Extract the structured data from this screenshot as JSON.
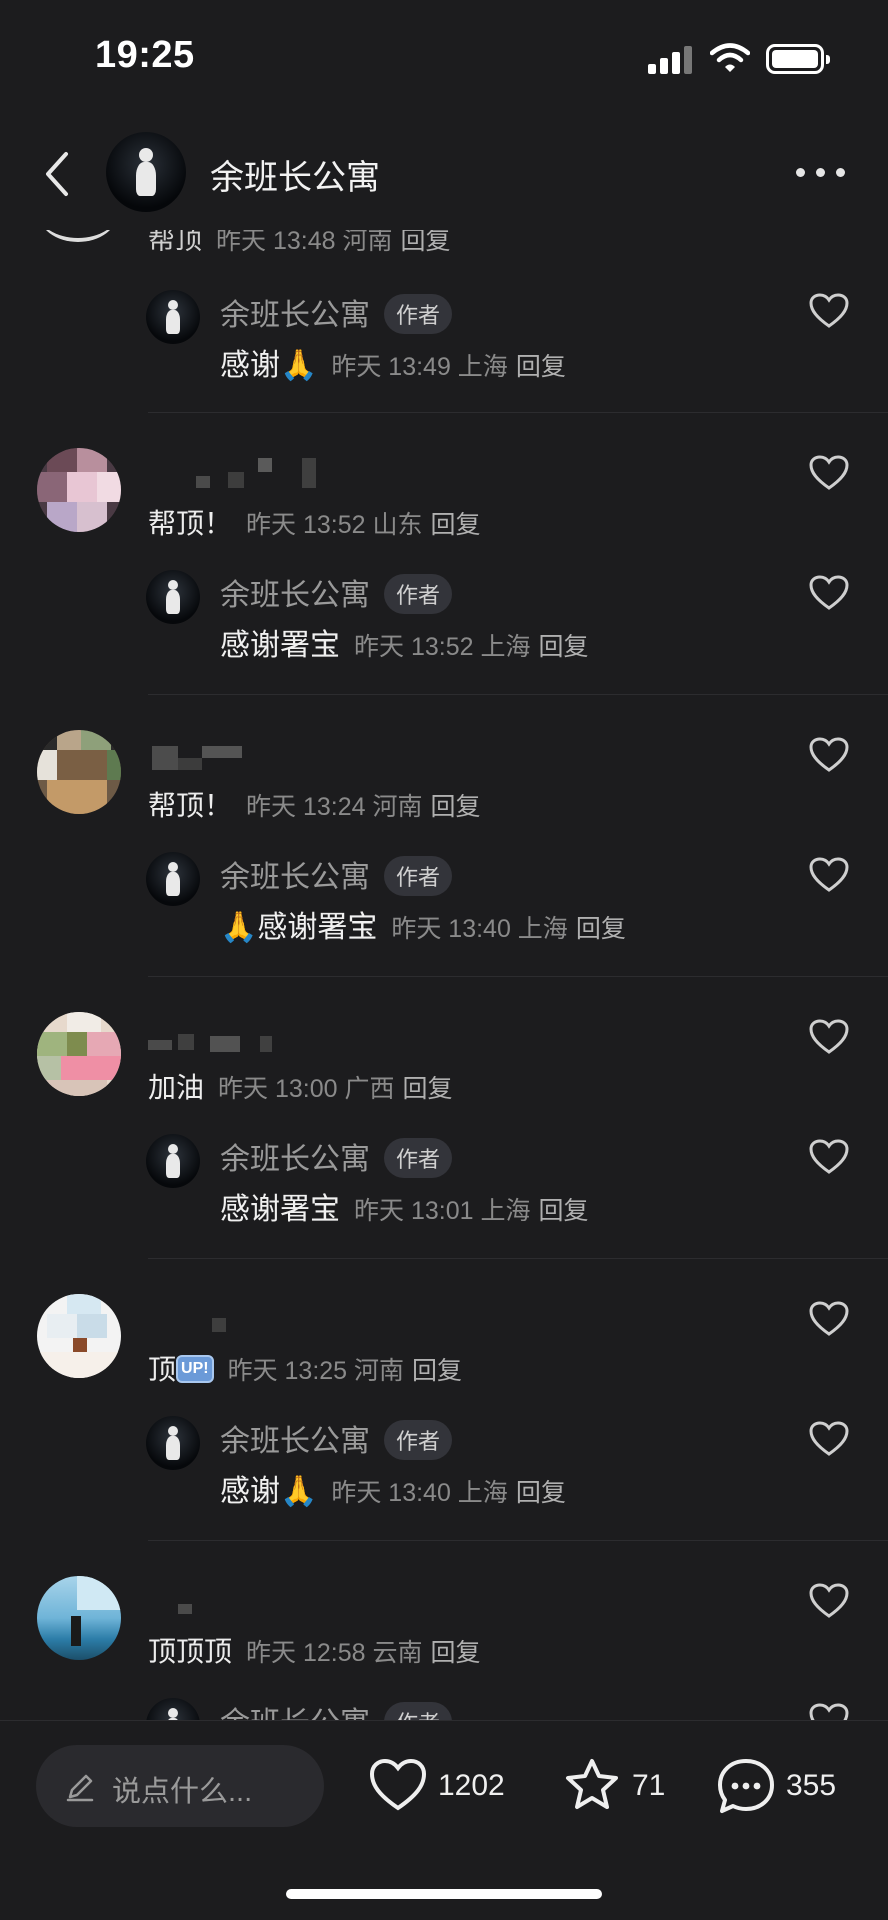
{
  "status_bar": {
    "time": "19:25"
  },
  "header": {
    "title": "余班长公寓",
    "back_icon": "chevron-left-icon",
    "more_icon": "ellipsis-icon"
  },
  "partial_top": {
    "name": "帮顶",
    "meta": "昨天 13:48 河南",
    "reply": "回复"
  },
  "author_badge": "作者",
  "comments": [
    {
      "text": "",
      "meta": "",
      "reply": "",
      "reply_item": {
        "name": "余班长公寓",
        "text": "感谢🙏",
        "meta": "昨天 13:49 上海",
        "reply": "回复"
      }
    },
    {
      "text": "帮顶！",
      "meta": "昨天 13:52 山东",
      "reply": "回复",
      "reply_item": {
        "name": "余班长公寓",
        "text": "感谢署宝",
        "meta": "昨天 13:52 上海",
        "reply": "回复"
      }
    },
    {
      "text": "帮顶！",
      "meta": "昨天 13:24 河南",
      "reply": "回复",
      "reply_item": {
        "name": "余班长公寓",
        "text": "🙏感谢署宝",
        "meta": "昨天 13:40 上海",
        "reply": "回复"
      }
    },
    {
      "text": "加油",
      "meta": "昨天 13:00 广西",
      "reply": "回复",
      "reply_item": {
        "name": "余班长公寓",
        "text": "感谢署宝",
        "meta": "昨天 13:01 上海",
        "reply": "回复"
      }
    },
    {
      "text": "顶",
      "up_badge": "UP!",
      "meta": "昨天 13:25 河南",
      "reply": "回复",
      "reply_item": {
        "name": "余班长公寓",
        "text": "感谢🙏",
        "meta": "昨天 13:40 上海",
        "reply": "回复"
      }
    },
    {
      "text": "顶顶顶",
      "meta": "昨天 12:58 云南",
      "reply": "回复",
      "reply_item": {
        "name": "余班长公寓",
        "text": "",
        "meta": "",
        "reply": ""
      }
    }
  ],
  "bottom_bar": {
    "input_placeholder": "说点什么...",
    "likes": "1202",
    "favorites": "71",
    "comments": "355"
  },
  "colors": {
    "background": "#1c1c1e",
    "text": "#ededed",
    "meta": "#8a8a8a"
  }
}
